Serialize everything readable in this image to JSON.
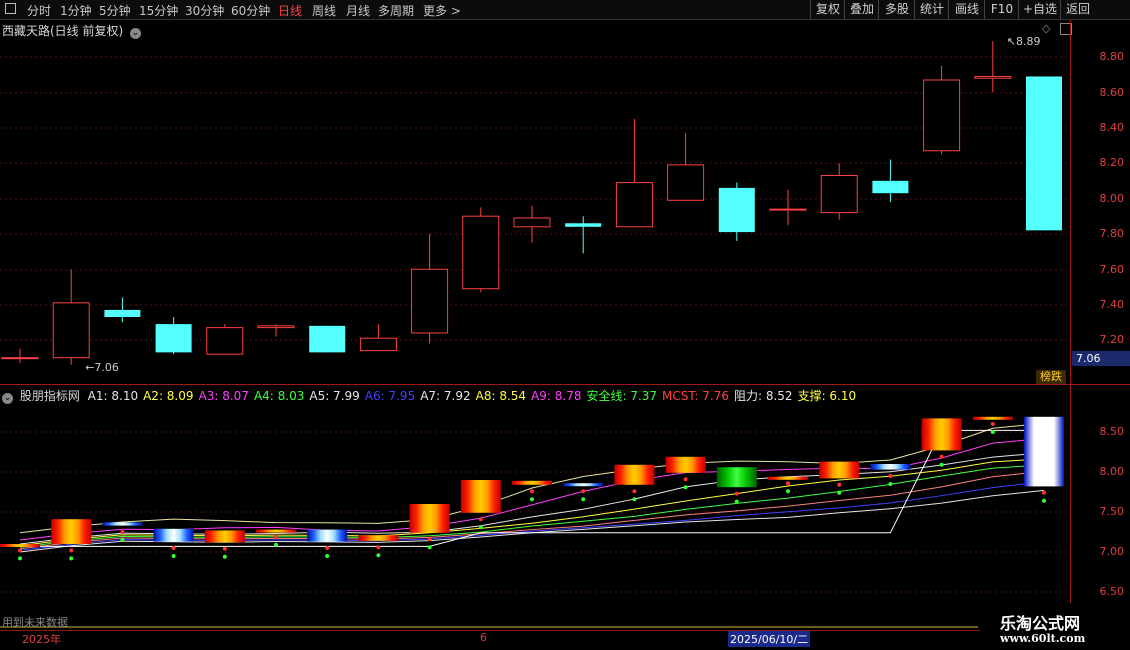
{
  "toolbar": {
    "left_items": [
      "分时",
      "1分钟",
      "5分钟",
      "15分钟",
      "30分钟",
      "60分钟",
      "日线",
      "周线",
      "月线",
      "多周期",
      "更多 >"
    ],
    "active": "日线",
    "right_items": [
      "复权",
      "叠加",
      "多股",
      "统计",
      "画线",
      "F10",
      "+自选",
      "返回"
    ]
  },
  "main_chart": {
    "title": "西藏天路(日线 前复权)",
    "price_ticks": [
      "8.80",
      "8.60",
      "8.40",
      "8.20",
      "8.00",
      "7.80",
      "7.60",
      "7.40",
      "7.20"
    ],
    "high_label": "8.89",
    "low_label": "7.06",
    "current_price": "7.06",
    "badge": "榜跌"
  },
  "indicator": {
    "name": "股朋指标网",
    "legend": [
      {
        "label": "A1: 8.10",
        "color": "#e6e6e6"
      },
      {
        "label": "A2: 8.09",
        "color": "#ffff40"
      },
      {
        "label": "A3: 8.07",
        "color": "#ff40ff"
      },
      {
        "label": "A4: 8.03",
        "color": "#40ff40"
      },
      {
        "label": "A5: 7.99",
        "color": "#e6e6e6"
      },
      {
        "label": "A6: 7.95",
        "color": "#4040ff"
      },
      {
        "label": "A7: 7.92",
        "color": "#e6e6e6"
      },
      {
        "label": "A8: 8.54",
        "color": "#ffff40"
      },
      {
        "label": "A9: 8.78",
        "color": "#ff40ff"
      },
      {
        "label": "安全线: 7.37",
        "color": "#40ff40"
      },
      {
        "label": "MCST: 7.76",
        "color": "#ff4040"
      },
      {
        "label": "阻力: 8.52",
        "color": "#e6e6e6"
      },
      {
        "label": "支撑: 6.10",
        "color": "#ffff40"
      }
    ],
    "ticks": [
      "8.50",
      "8.00",
      "7.50",
      "7.00",
      "6.50"
    ]
  },
  "footer": {
    "note": "用到未来数据",
    "year": "2025年",
    "month": "6",
    "date": "2025/06/10/二"
  },
  "watermark": {
    "line1": "乐淘公式网",
    "line2": "www.60lt.com"
  },
  "chart_data": {
    "type": "candlestick",
    "ylim": [
      7.06,
      8.89
    ],
    "candles": [
      {
        "o": 7.1,
        "c": 7.1,
        "h": 7.15,
        "l": 7.07
      },
      {
        "o": 7.1,
        "c": 7.41,
        "h": 7.6,
        "l": 7.06
      },
      {
        "o": 7.37,
        "c": 7.33,
        "h": 7.44,
        "l": 7.3
      },
      {
        "o": 7.29,
        "c": 7.13,
        "h": 7.33,
        "l": 7.12
      },
      {
        "o": 7.12,
        "c": 7.27,
        "h": 7.29,
        "l": 7.12
      },
      {
        "o": 7.27,
        "c": 7.28,
        "h": 7.29,
        "l": 7.22
      },
      {
        "o": 7.28,
        "c": 7.13,
        "h": 7.28,
        "l": 7.13
      },
      {
        "o": 7.14,
        "c": 7.21,
        "h": 7.29,
        "l": 7.14
      },
      {
        "o": 7.24,
        "c": 7.6,
        "h": 7.8,
        "l": 7.18
      },
      {
        "o": 7.49,
        "c": 7.9,
        "h": 7.95,
        "l": 7.47
      },
      {
        "o": 7.84,
        "c": 7.89,
        "h": 7.96,
        "l": 7.75
      },
      {
        "o": 7.86,
        "c": 7.84,
        "h": 7.9,
        "l": 7.69
      },
      {
        "o": 7.84,
        "c": 8.09,
        "h": 8.45,
        "l": 7.84
      },
      {
        "o": 7.99,
        "c": 8.19,
        "h": 8.37,
        "l": 7.99
      },
      {
        "o": 8.06,
        "c": 7.81,
        "h": 8.09,
        "l": 7.76
      },
      {
        "o": 7.94,
        "c": 7.94,
        "h": 8.05,
        "l": 7.85
      },
      {
        "o": 7.92,
        "c": 8.13,
        "h": 8.2,
        "l": 7.88
      },
      {
        "o": 8.1,
        "c": 8.03,
        "h": 8.22,
        "l": 7.98
      },
      {
        "o": 8.27,
        "c": 8.67,
        "h": 8.75,
        "l": 8.25
      },
      {
        "o": 8.68,
        "c": 8.69,
        "h": 8.89,
        "l": 8.6
      },
      {
        "o": 8.69,
        "c": 7.82,
        "h": 8.69,
        "l": 7.82
      }
    ]
  }
}
